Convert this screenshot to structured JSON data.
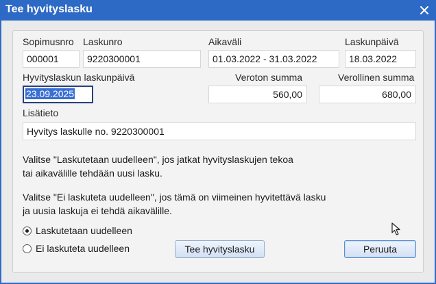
{
  "window": {
    "title": "Tee hyvityslasku"
  },
  "labels": {
    "contract": "Sopimusnro",
    "invoice_no": "Laskunro",
    "period": "Aikaväli",
    "invoice_date": "Laskunpäivä",
    "credit_invoice_date": "Hyvityslaskun laskunpäivä",
    "net_sum": "Veroton summa",
    "gross_sum": "Verollinen summa",
    "extra_info": "Lisätieto"
  },
  "fields": {
    "contract": "000001",
    "invoice_no": "9220300001",
    "period": "01.03.2022 - 31.03.2022",
    "invoice_date": "18.03.2022",
    "credit_invoice_date": "23.09.2025",
    "net_sum": "560,00",
    "gross_sum": "680,00",
    "extra_info": "Hyvitys laskulle no. 9220300001"
  },
  "info": {
    "line1": "Valitse \"Laskutetaan uudelleen\", jos jatkat hyvityslaskujen tekoa",
    "line2": "tai aikavälille tehdään uusi lasku.",
    "line3": "Valitse \"Ei laskuteta uudelleen\", jos tämä on viimeinen hyvitettävä lasku",
    "line4": "ja uusia laskuja ei tehdä aikavälille."
  },
  "radios": {
    "rebill": "Laskutetaan uudelleen",
    "no_rebill": "Ei laskuteta uudelleen",
    "selected": "rebill"
  },
  "buttons": {
    "create": "Tee hyvityslasku",
    "cancel": "Peruuta"
  },
  "colors": {
    "titlebar": "#2d6ac6",
    "selection": "#3a6fd2",
    "focus_border": "#27407e"
  }
}
